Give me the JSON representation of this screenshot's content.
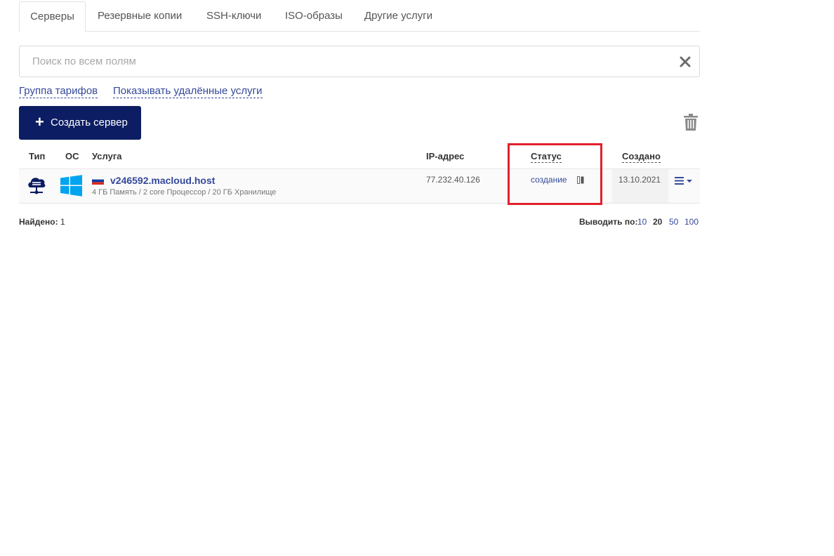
{
  "tabs": [
    {
      "label": "Серверы",
      "active": true
    },
    {
      "label": "Резервные копии",
      "active": false
    },
    {
      "label": "SSH-ключи",
      "active": false
    },
    {
      "label": "ISO-образы",
      "active": false
    },
    {
      "label": "Другие услуги",
      "active": false
    }
  ],
  "search": {
    "placeholder": "Поиск по всем полям",
    "value": ""
  },
  "filters": {
    "tariff_group": "Группа тарифов",
    "show_deleted": "Показывать удалённые услуги"
  },
  "toolbar": {
    "create_label": "Создать сервер"
  },
  "table": {
    "columns": {
      "type": "Тип",
      "os": "ОС",
      "service": "Услуга",
      "ip": "IP-адрес",
      "status": "Статус",
      "created": "Создано"
    },
    "rows": [
      {
        "type_icon": "cloud-server-icon",
        "os_icon": "windows-icon",
        "flag": "russia-flag-icon",
        "name": "v246592.macloud.host",
        "description": "4 ГБ Память / 2 core Процессор / 20 ГБ Хранилище",
        "ip": "77.232.40.126",
        "status": "создание",
        "created": "13.10.2021"
      }
    ]
  },
  "footer": {
    "found_label": "Найдено:",
    "found_count": "1",
    "per_page_label": "Выводить по:",
    "per_page_options": [
      "10",
      "20",
      "50",
      "100"
    ],
    "per_page_selected": "20"
  },
  "colors": {
    "primary": "#0d1d63",
    "link": "#34499a",
    "highlight": "#e2202b",
    "windows": "#00a4ef"
  }
}
